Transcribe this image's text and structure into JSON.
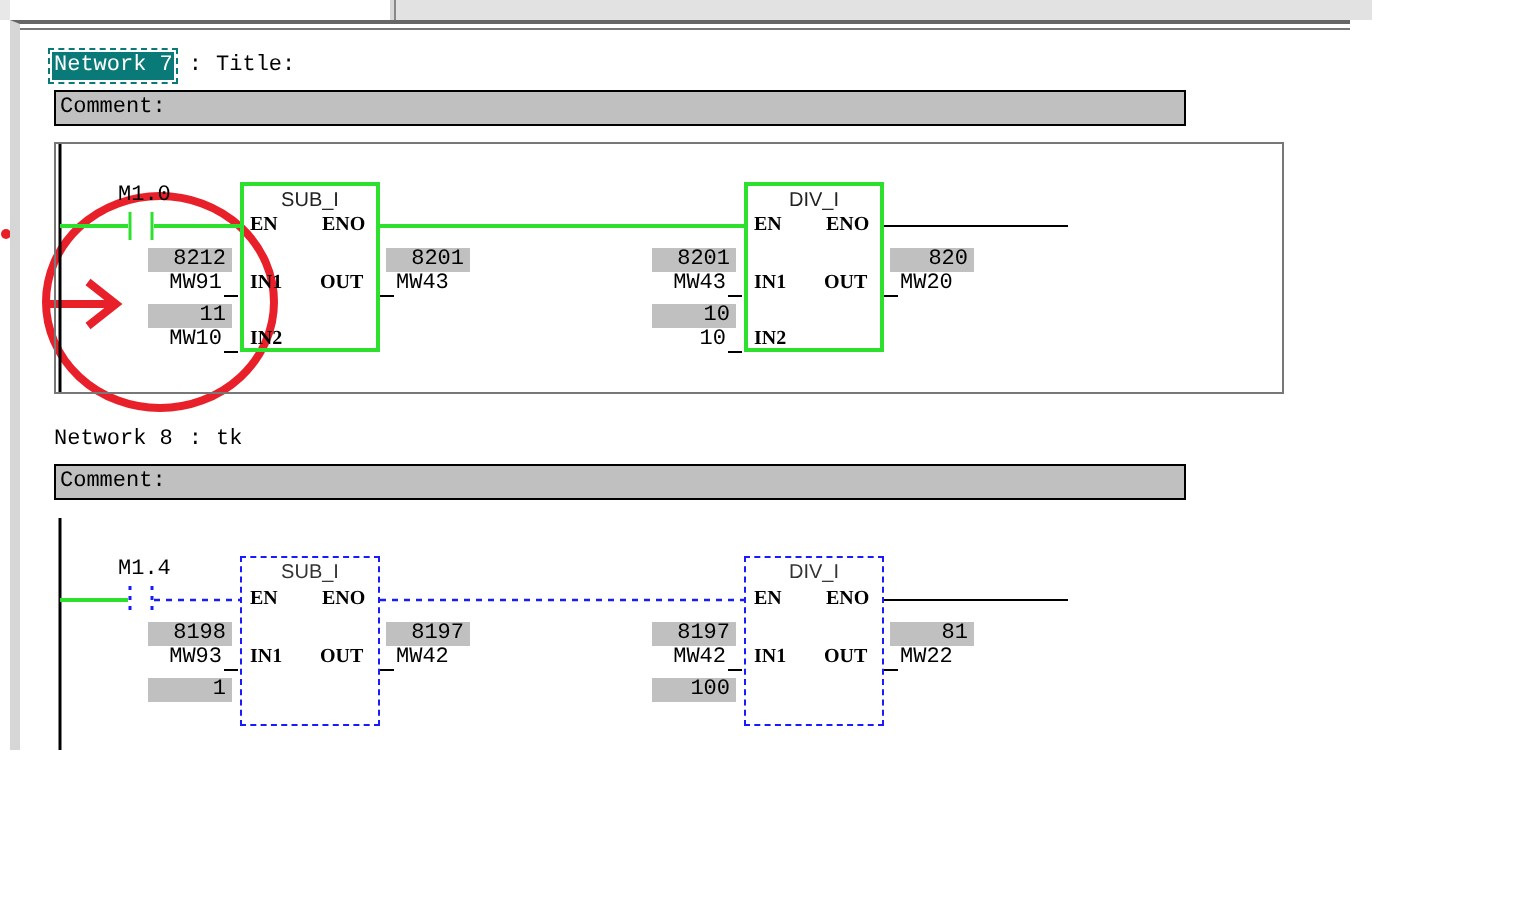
{
  "networks": [
    {
      "label": "Network 7",
      "selected": true,
      "separator": ":",
      "title": "Title:",
      "comment": "Comment:",
      "contact": {
        "address": "M1.0",
        "powered": true
      },
      "boxes": [
        {
          "name": "SUB_I",
          "powered": true,
          "en": "EN",
          "eno": "ENO",
          "in1": {
            "pin": "IN1",
            "value": "8212",
            "address": "MW91"
          },
          "in2": {
            "pin": "IN2",
            "value": "11",
            "address": "MW10"
          },
          "out": {
            "pin": "OUT",
            "value": "8201",
            "address": "MW43"
          }
        },
        {
          "name": "DIV_I",
          "powered": true,
          "en": "EN",
          "eno": "ENO",
          "in1": {
            "pin": "IN1",
            "value": "8201",
            "address": "MW43"
          },
          "in2": {
            "pin": "IN2",
            "value": "10",
            "address": "10"
          },
          "out": {
            "pin": "OUT",
            "value": "820",
            "address": "MW20"
          }
        }
      ]
    },
    {
      "label": "Network 8",
      "selected": false,
      "separator": ":",
      "title": "tk",
      "comment": "Comment:",
      "contact": {
        "address": "M1.4",
        "powered": false
      },
      "boxes": [
        {
          "name": "SUB_I",
          "powered": false,
          "en": "EN",
          "eno": "ENO",
          "in1": {
            "pin": "IN1",
            "value": "8198",
            "address": "MW93"
          },
          "in2": {
            "value": "1"
          },
          "out": {
            "pin": "OUT",
            "value": "8197",
            "address": "MW42"
          }
        },
        {
          "name": "DIV_I",
          "powered": false,
          "en": "EN",
          "eno": "ENO",
          "in1": {
            "pin": "IN1",
            "value": "8197",
            "address": "MW42"
          },
          "in2": {
            "value": "100"
          },
          "out": {
            "pin": "OUT",
            "value": "81",
            "address": "MW22"
          }
        }
      ]
    }
  ]
}
